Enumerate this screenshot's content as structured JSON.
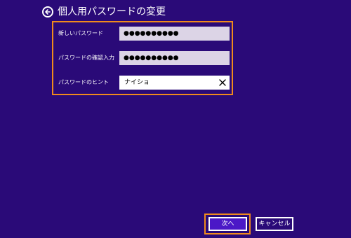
{
  "header": {
    "title": "個人用パスワードの変更",
    "back_icon": "back-arrow-icon"
  },
  "form": {
    "new_password": {
      "label": "新しいパスワード",
      "value": "●●●●●●●●●●"
    },
    "confirm_password": {
      "label": "パスワードの確認入力",
      "value": "●●●●●●●●●●"
    },
    "hint": {
      "label": "パスワードのヒント",
      "value": "ナイショ",
      "clear_icon": "clear-icon"
    }
  },
  "buttons": {
    "next_label": "次へ",
    "cancel_label": "キャンセル"
  },
  "colors": {
    "background": "#2a0a78",
    "highlight": "#f08a1c",
    "primary_button": "#4b18c7",
    "password_field": "#dcd4e6"
  }
}
